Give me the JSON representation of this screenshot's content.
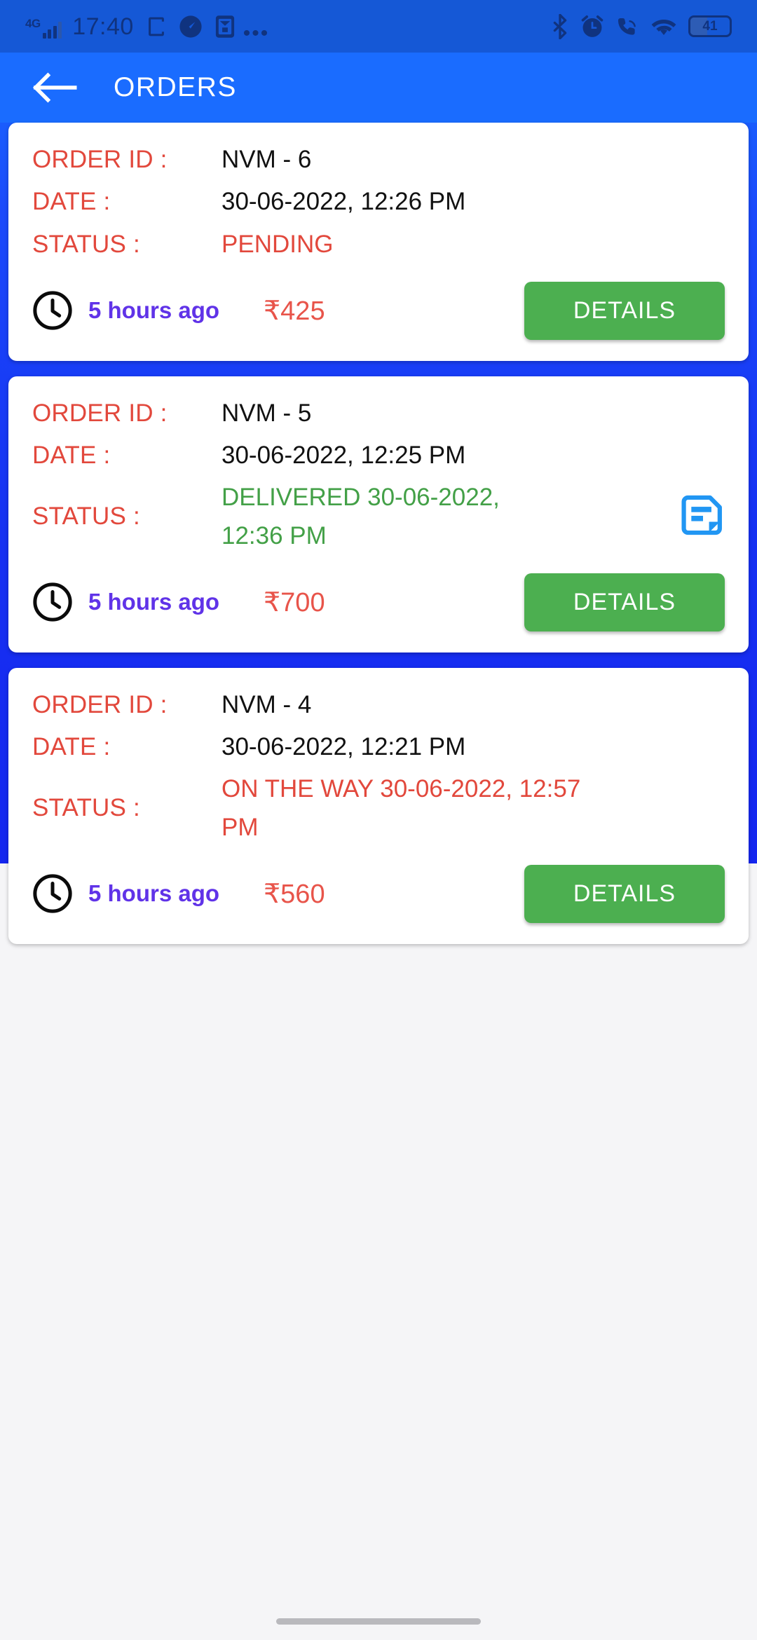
{
  "statusbar": {
    "network_type": "4G",
    "time": "17:40",
    "overflow_dots": "•••",
    "battery_percent": "41",
    "icons": [
      "signal-icon",
      "rotation-lock-icon",
      "speedometer-icon",
      "mail-icon",
      "more-icon",
      "bluetooth-icon",
      "alarm-icon",
      "call-wifi-icon",
      "wifi-icon",
      "battery-icon"
    ]
  },
  "appbar": {
    "back_label": "back",
    "title": "ORDERS"
  },
  "labels": {
    "order_id": "ORDER ID :",
    "date": "DATE :",
    "status": "STATUS :",
    "details_button": "DETAILS"
  },
  "colors": {
    "statusbar_bg": "#1558d6",
    "appbar_bg": "#1a6cff",
    "page_bg": "#1833f5",
    "card_bg": "#ffffff",
    "label_red": "#e2483c",
    "status_green": "#43a047",
    "price_red": "#e8544a",
    "ago_purple": "#6033e8",
    "details_green": "#4caf50",
    "note_icon_blue": "#2196f3",
    "bottom_bg": "#f5f5f7"
  },
  "orders": [
    {
      "order_id": "NVM - 6",
      "date": "30-06-2022, 12:26 PM",
      "status_text": "PENDING",
      "status_kind": "pending",
      "has_note_icon": false,
      "relative_time": "5 hours ago",
      "price": "₹425",
      "details_button": "DETAILS"
    },
    {
      "order_id": "NVM - 5",
      "date": "30-06-2022, 12:25 PM",
      "status_text": "DELIVERED 30-06-2022, 12:36 PM",
      "status_kind": "delivered",
      "has_note_icon": true,
      "relative_time": "5 hours ago",
      "price": "₹700",
      "details_button": "DETAILS"
    },
    {
      "order_id": "NVM - 4",
      "date": "30-06-2022, 12:21 PM",
      "status_text": "ON THE WAY 30-06-2022, 12:57 PM",
      "status_kind": "onway",
      "has_note_icon": false,
      "relative_time": "5 hours ago",
      "price": "₹560",
      "details_button": "DETAILS"
    }
  ]
}
